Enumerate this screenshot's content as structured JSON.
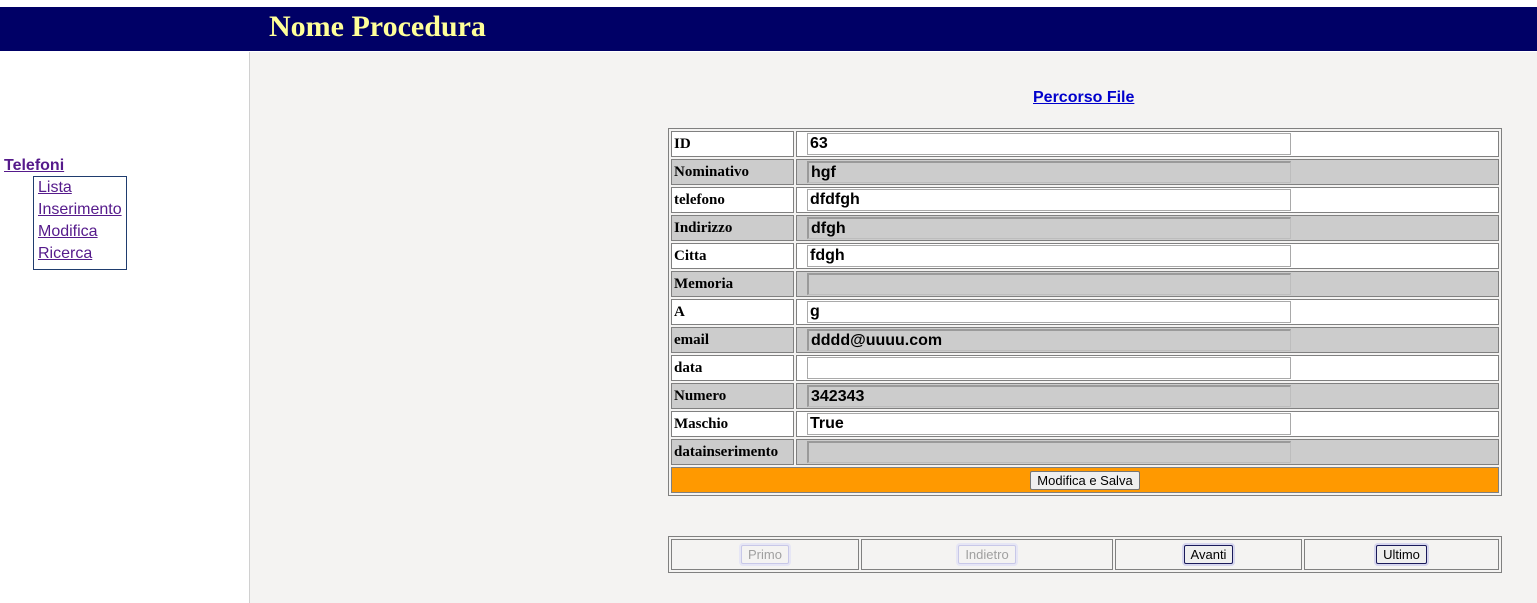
{
  "header": {
    "title": "Nome Procedura"
  },
  "sidebar": {
    "menu_title": "Telefoni",
    "items": [
      {
        "label": "Lista"
      },
      {
        "label": "Inserimento"
      },
      {
        "label": "Modifica"
      },
      {
        "label": "Ricerca"
      }
    ]
  },
  "main": {
    "path_link": "Percorso File",
    "fields": [
      {
        "label": "ID",
        "value": "63"
      },
      {
        "label": "Nominativo",
        "value": "hgf"
      },
      {
        "label": "telefono",
        "value": "dfdfgh"
      },
      {
        "label": "Indirizzo",
        "value": "dfgh"
      },
      {
        "label": "Citta",
        "value": "fdgh"
      },
      {
        "label": "Memoria",
        "value": ""
      },
      {
        "label": "A",
        "value": "g"
      },
      {
        "label": "email",
        "value": "dddd@uuuu.com"
      },
      {
        "label": "data",
        "value": ""
      },
      {
        "label": "Numero",
        "value": "342343"
      },
      {
        "label": "Maschio",
        "value": "True"
      },
      {
        "label": "datainserimento",
        "value": ""
      }
    ],
    "save_button": "Modifica e Salva",
    "nav": {
      "first": "Primo",
      "back": "Indietro",
      "next": "Avanti",
      "last": "Ultimo"
    }
  },
  "colors": {
    "header_bg": "#000066",
    "header_text": "#ffff99",
    "save_row_bg": "#ff9900",
    "link": "#0000cc",
    "visited_link": "#551a8b"
  }
}
